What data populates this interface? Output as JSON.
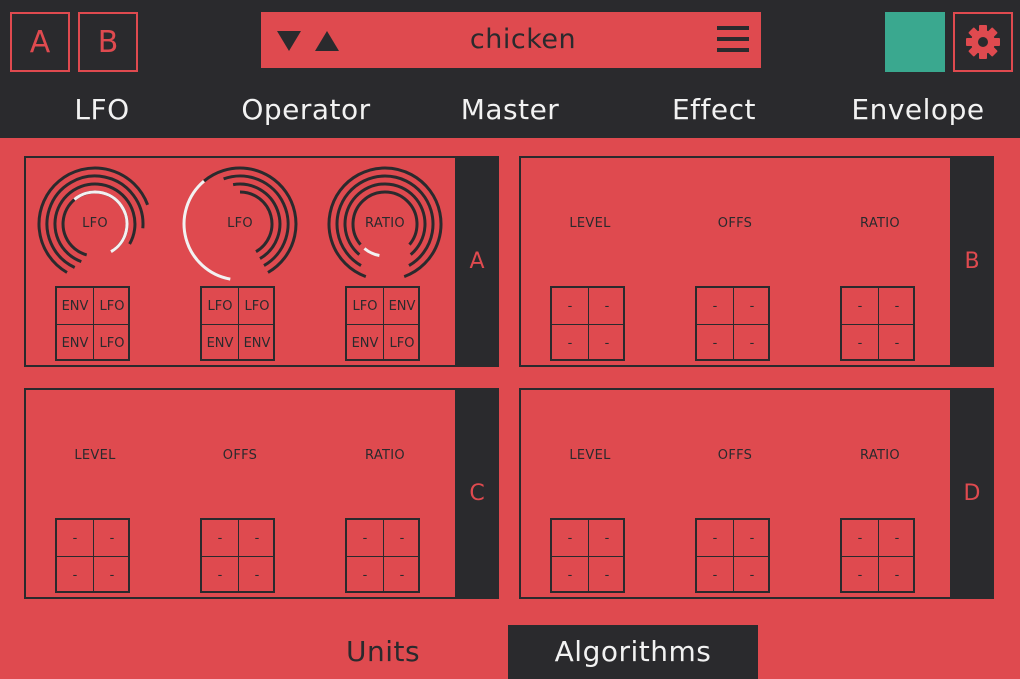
{
  "colors": {
    "accent": "#df4a4f",
    "dark": "#2a2a2d",
    "swatch": "#3aa88f",
    "light": "#f2f2f2"
  },
  "header": {
    "slot_a": "A",
    "slot_b": "B",
    "preset_name": "chicken",
    "icons": [
      "arrow-down-icon",
      "arrow-up-icon",
      "menu-icon",
      "gear-icon"
    ]
  },
  "tabs": [
    {
      "label": "LFO",
      "active": false
    },
    {
      "label": "Operator",
      "active": true
    },
    {
      "label": "Master",
      "active": false
    },
    {
      "label": "Effect",
      "active": false
    },
    {
      "label": "Envelope",
      "active": false
    }
  ],
  "operators": [
    {
      "id": "A",
      "knobs": [
        {
          "label": "LFO",
          "mods": [
            "ENV",
            "LFO",
            "ENV",
            "LFO"
          ]
        },
        {
          "label": "LFO",
          "mods": [
            "LFO",
            "LFO",
            "ENV",
            "ENV"
          ]
        },
        {
          "label": "RATIO",
          "mods": [
            "LFO",
            "ENV",
            "ENV",
            "LFO"
          ]
        }
      ]
    },
    {
      "id": "B",
      "knobs": [
        {
          "label": "LEVEL",
          "mods": [
            "-",
            "-",
            "-",
            "-"
          ]
        },
        {
          "label": "OFFS",
          "mods": [
            "-",
            "-",
            "-",
            "-"
          ]
        },
        {
          "label": "RATIO",
          "mods": [
            "-",
            "-",
            "-",
            "-"
          ]
        }
      ]
    },
    {
      "id": "C",
      "knobs": [
        {
          "label": "LEVEL",
          "mods": [
            "-",
            "-",
            "-",
            "-"
          ]
        },
        {
          "label": "OFFS",
          "mods": [
            "-",
            "-",
            "-",
            "-"
          ]
        },
        {
          "label": "RATIO",
          "mods": [
            "-",
            "-",
            "-",
            "-"
          ]
        }
      ]
    },
    {
      "id": "D",
      "knobs": [
        {
          "label": "LEVEL",
          "mods": [
            "-",
            "-",
            "-",
            "-"
          ]
        },
        {
          "label": "OFFS",
          "mods": [
            "-",
            "-",
            "-",
            "-"
          ]
        },
        {
          "label": "RATIO",
          "mods": [
            "-",
            "-",
            "-",
            "-"
          ]
        }
      ]
    }
  ],
  "bottom_tabs": [
    {
      "label": "Units",
      "active": false
    },
    {
      "label": "Algorithms",
      "active": true
    }
  ]
}
